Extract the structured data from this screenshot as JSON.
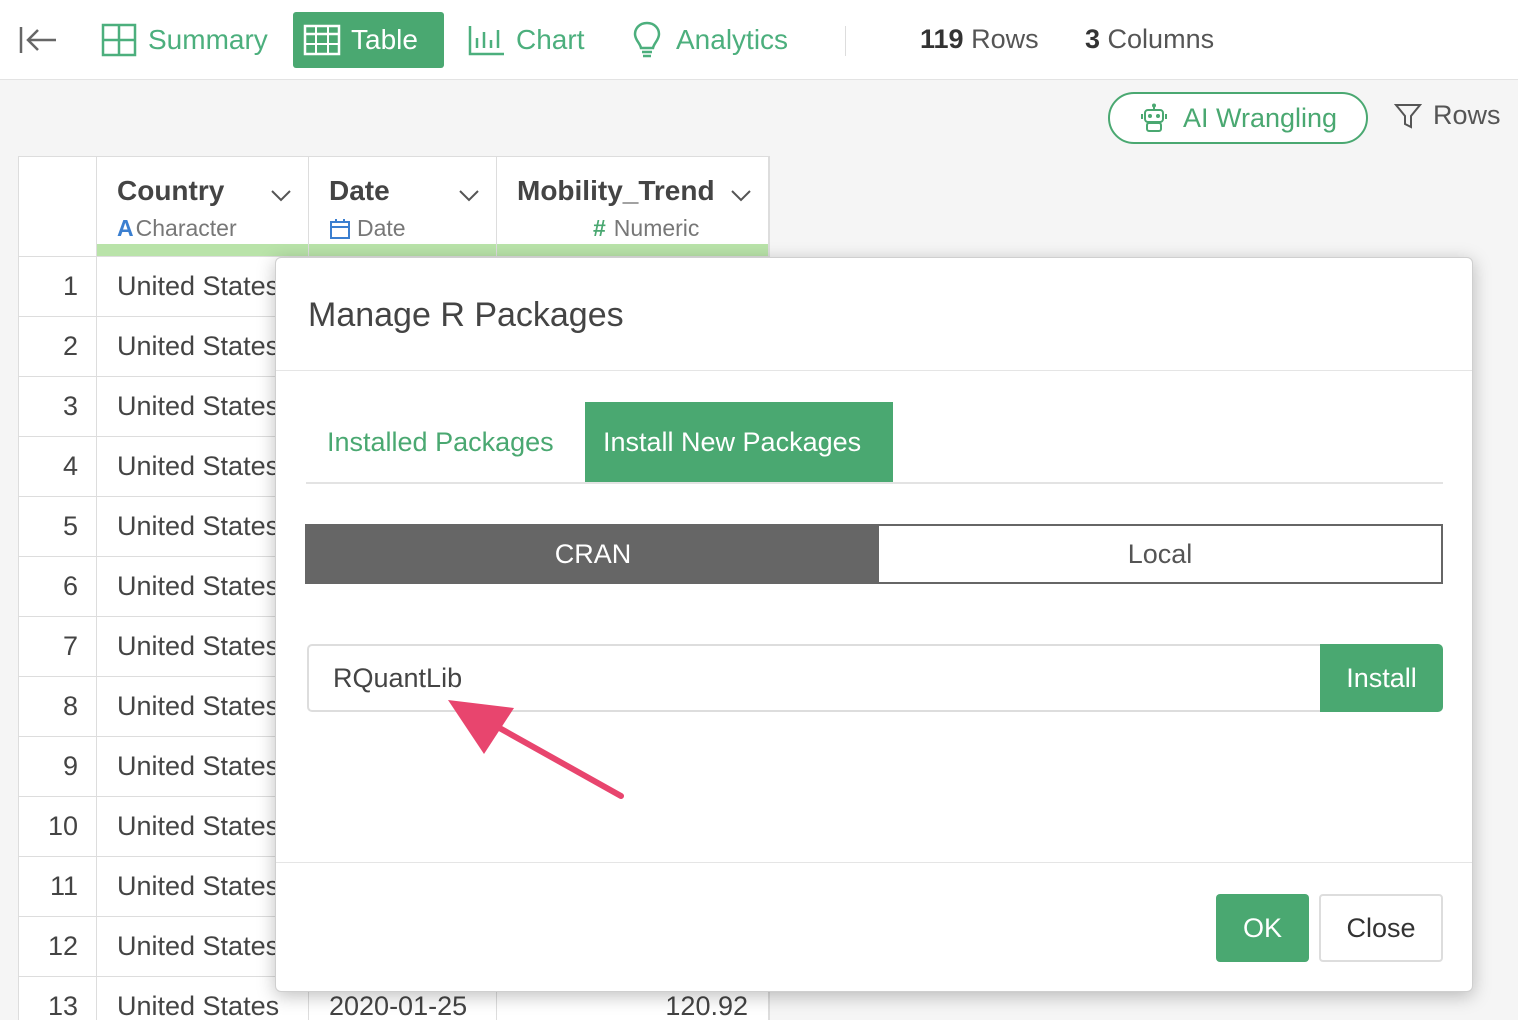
{
  "toolbar": {
    "tabs": [
      {
        "label": "Summary",
        "icon": "summary-grid-icon",
        "active": false
      },
      {
        "label": "Table",
        "icon": "table-icon",
        "active": true
      },
      {
        "label": "Chart",
        "icon": "bar-chart-icon",
        "active": false
      },
      {
        "label": "Analytics",
        "icon": "lightbulb-icon",
        "active": false
      }
    ],
    "rows_count": "119",
    "rows_label": "Rows",
    "columns_count": "3",
    "columns_label": "Columns"
  },
  "actions": {
    "ai_wrangling_label": "AI Wrangling",
    "rows_filter_label": "Rows"
  },
  "table": {
    "columns": [
      {
        "name": "Country",
        "type": "Character",
        "type_glyph": "A"
      },
      {
        "name": "Date",
        "type": "Date"
      },
      {
        "name": "Mobility_Trend",
        "type": "Numeric",
        "type_glyph": "#"
      }
    ],
    "rows": [
      {
        "n": "1",
        "country": "United States",
        "date": "",
        "value": ""
      },
      {
        "n": "2",
        "country": "United States",
        "date": "",
        "value": ""
      },
      {
        "n": "3",
        "country": "United States",
        "date": "",
        "value": ""
      },
      {
        "n": "4",
        "country": "United States",
        "date": "",
        "value": ""
      },
      {
        "n": "5",
        "country": "United States",
        "date": "",
        "value": ""
      },
      {
        "n": "6",
        "country": "United States",
        "date": "",
        "value": ""
      },
      {
        "n": "7",
        "country": "United States",
        "date": "",
        "value": ""
      },
      {
        "n": "8",
        "country": "United States",
        "date": "",
        "value": ""
      },
      {
        "n": "9",
        "country": "United States",
        "date": "",
        "value": ""
      },
      {
        "n": "10",
        "country": "United States",
        "date": "",
        "value": ""
      },
      {
        "n": "11",
        "country": "United States",
        "date": "",
        "value": ""
      },
      {
        "n": "12",
        "country": "United States",
        "date": "",
        "value": ""
      },
      {
        "n": "13",
        "country": "United States",
        "date": "2020-01-25",
        "value": "120.92"
      }
    ]
  },
  "dialog": {
    "title": "Manage R Packages",
    "tabs": {
      "installed": "Installed Packages",
      "install_new": "Install New Packages"
    },
    "source": {
      "cran": "CRAN",
      "local": "Local",
      "selected": "CRAN"
    },
    "package_input_value": "RQuantLib",
    "install_label": "Install",
    "ok_label": "OK",
    "close_label": "Close"
  },
  "colors": {
    "accent_green": "#4aa871",
    "segment_dark": "#666666",
    "annotation_pink": "#e8456e",
    "header_bar": "#b9e3a9"
  }
}
